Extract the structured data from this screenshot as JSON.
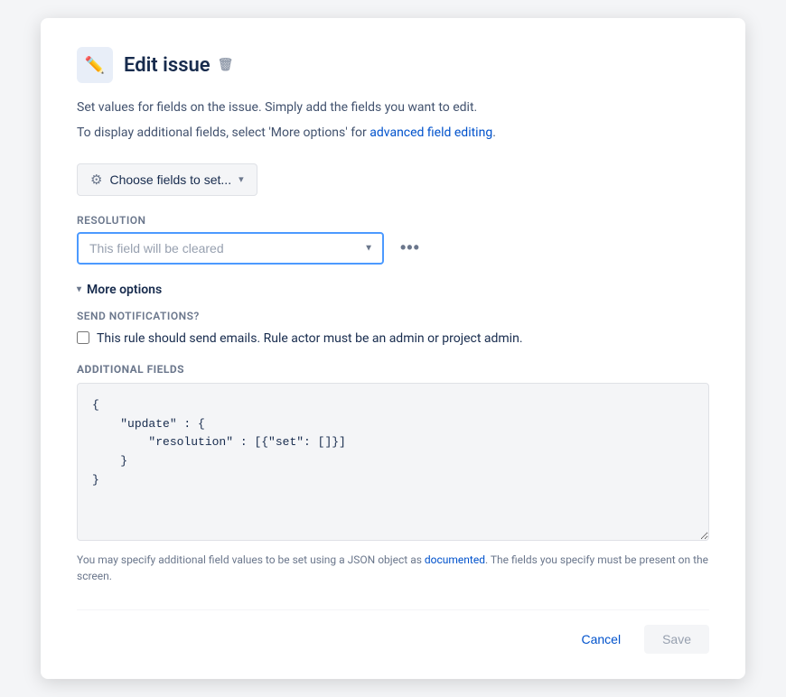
{
  "modal": {
    "title": "Edit issue",
    "description_line1": "Set values for fields on the issue. Simply add the fields you want to edit.",
    "description_line2_prefix": "To display additional fields, select 'More options' for ",
    "description_link": "advanced field editing",
    "description_line2_suffix": ".",
    "choose_fields_button": "Choose fields to set...",
    "resolution_label": "Resolution",
    "resolution_placeholder": "This field will be cleared",
    "more_options_label": "More options",
    "send_notifications_label": "Send notifications?",
    "checkbox_label": "This rule should send emails. Rule actor must be an admin or project admin.",
    "additional_fields_label": "Additional fields",
    "json_content": "{\n    \"update\" : {\n        \"resolution\" : [{\"set\": []}]\n    }\n}",
    "json_hint_prefix": "You may specify additional field values to be set using a JSON object as ",
    "json_hint_link": "documented",
    "json_hint_suffix": ". The fields you specify must be present on the screen.",
    "cancel_button": "Cancel",
    "save_button": "Save",
    "icons": {
      "edit": "✏️",
      "trash": "🗑",
      "gear": "⚙",
      "chevron_down": "▾",
      "chevron_right": "❯",
      "more_actions": "•••"
    }
  }
}
